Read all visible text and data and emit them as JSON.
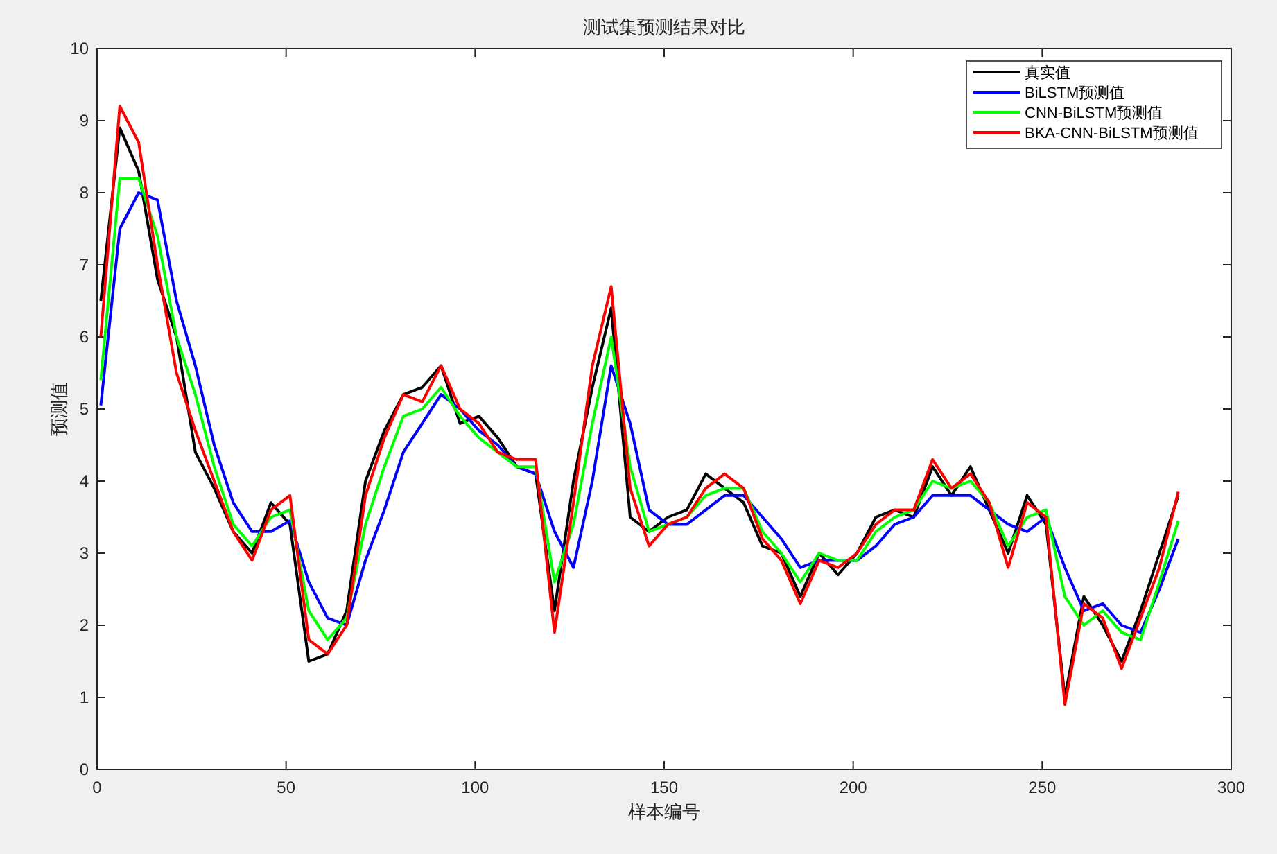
{
  "chart": {
    "chart_data": {
      "type": "line",
      "title": "测试集预测结果对比",
      "xlabel": "样本编号",
      "ylabel": "预测值",
      "x": [
        1,
        6,
        11,
        16,
        21,
        26,
        31,
        36,
        41,
        46,
        51,
        56,
        61,
        66,
        71,
        76,
        81,
        86,
        91,
        96,
        101,
        106,
        111,
        116,
        121,
        126,
        131,
        136,
        141,
        146,
        151,
        156,
        161,
        166,
        171,
        176,
        181,
        186,
        191,
        196,
        201,
        206,
        211,
        216,
        221,
        226,
        231,
        236,
        241,
        246,
        251,
        256,
        261,
        266,
        271,
        276,
        281,
        286
      ],
      "series": [
        {
          "name": "真实值",
          "color": "#000000",
          "values": [
            6.5,
            8.9,
            8.3,
            6.8,
            6.0,
            4.4,
            3.9,
            3.3,
            3.0,
            3.7,
            3.4,
            1.5,
            1.6,
            2.2,
            4.0,
            4.7,
            5.2,
            5.3,
            5.6,
            4.8,
            4.9,
            4.6,
            4.2,
            4.1,
            2.2,
            4.0,
            5.3,
            6.4,
            3.5,
            3.3,
            3.5,
            3.6,
            4.1,
            3.9,
            3.7,
            3.1,
            3.0,
            2.4,
            3.0,
            2.7,
            3.0,
            3.5,
            3.6,
            3.5,
            4.2,
            3.8,
            4.2,
            3.6,
            3.0,
            3.8,
            3.4,
            1.0,
            2.4,
            2.0,
            1.5,
            2.2,
            3.0,
            3.8
          ]
        },
        {
          "name": "BiLSTM预测值",
          "color": "#0000ff",
          "values": [
            5.05,
            7.5,
            8.0,
            7.9,
            6.5,
            5.6,
            4.5,
            3.7,
            3.3,
            3.3,
            3.45,
            2.6,
            2.1,
            2.0,
            2.9,
            3.6,
            4.4,
            4.8,
            5.2,
            5.0,
            4.7,
            4.5,
            4.2,
            4.1,
            3.3,
            2.8,
            4.0,
            5.6,
            4.8,
            3.6,
            3.4,
            3.4,
            3.6,
            3.8,
            3.8,
            3.5,
            3.2,
            2.8,
            2.9,
            2.9,
            2.9,
            3.1,
            3.4,
            3.5,
            3.8,
            3.8,
            3.8,
            3.6,
            3.4,
            3.3,
            3.5,
            2.8,
            2.2,
            2.3,
            2.0,
            1.9,
            2.5,
            3.2
          ]
        },
        {
          "name": "CNN-BiLSTM预测值",
          "color": "#00ff00",
          "values": [
            5.4,
            8.2,
            8.2,
            7.4,
            6.0,
            5.2,
            4.2,
            3.4,
            3.1,
            3.5,
            3.6,
            2.2,
            1.8,
            2.1,
            3.4,
            4.2,
            4.9,
            5.0,
            5.3,
            4.9,
            4.6,
            4.4,
            4.2,
            4.2,
            2.6,
            3.4,
            4.8,
            6.0,
            4.2,
            3.3,
            3.4,
            3.5,
            3.8,
            3.9,
            3.9,
            3.3,
            3.0,
            2.6,
            3.0,
            2.9,
            2.9,
            3.3,
            3.5,
            3.6,
            4.0,
            3.9,
            4.0,
            3.7,
            3.1,
            3.5,
            3.6,
            2.4,
            2.0,
            2.2,
            1.9,
            1.8,
            2.6,
            3.45
          ]
        },
        {
          "name": "BKA-CNN-BiLSTM预测值",
          "color": "#ff0000",
          "values": [
            6.0,
            9.2,
            8.7,
            7.0,
            5.5,
            4.7,
            4.0,
            3.3,
            2.9,
            3.6,
            3.8,
            1.8,
            1.6,
            2.0,
            3.8,
            4.6,
            5.2,
            5.1,
            5.6,
            5.0,
            4.8,
            4.4,
            4.3,
            4.3,
            1.9,
            3.7,
            5.6,
            6.7,
            3.9,
            3.1,
            3.4,
            3.5,
            3.9,
            4.1,
            3.9,
            3.2,
            2.9,
            2.3,
            2.9,
            2.8,
            3.0,
            3.4,
            3.6,
            3.6,
            4.3,
            3.9,
            4.1,
            3.7,
            2.8,
            3.7,
            3.5,
            0.9,
            2.3,
            2.1,
            1.4,
            2.1,
            2.8,
            3.85
          ]
        }
      ],
      "legend": true,
      "xlim": [
        0,
        300
      ],
      "ylim": [
        0,
        10
      ],
      "xticks": [
        0,
        50,
        100,
        150,
        200,
        250,
        300
      ],
      "yticks": [
        0,
        1,
        2,
        3,
        4,
        5,
        6,
        7,
        8,
        9,
        10
      ]
    }
  }
}
